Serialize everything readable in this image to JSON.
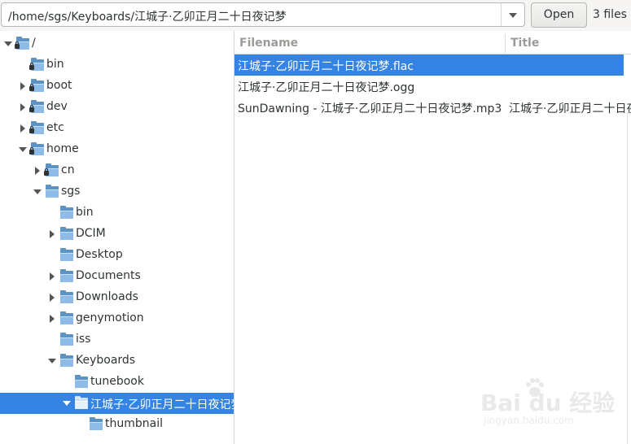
{
  "path_bar": {
    "path": "/home/sgs/Keyboards/江城子·乙卯正月二十日夜记梦",
    "open_label": "Open",
    "file_count": "3 files"
  },
  "tree": [
    {
      "label": "/",
      "depth": 0,
      "state": "expanded",
      "locked": true,
      "selected": false
    },
    {
      "label": "bin",
      "depth": 1,
      "state": "none",
      "locked": true,
      "selected": false
    },
    {
      "label": "boot",
      "depth": 1,
      "state": "collapsed",
      "locked": true,
      "selected": false
    },
    {
      "label": "dev",
      "depth": 1,
      "state": "collapsed",
      "locked": true,
      "selected": false
    },
    {
      "label": "etc",
      "depth": 1,
      "state": "collapsed",
      "locked": true,
      "selected": false
    },
    {
      "label": "home",
      "depth": 1,
      "state": "expanded",
      "locked": true,
      "selected": false
    },
    {
      "label": "cn",
      "depth": 2,
      "state": "collapsed",
      "locked": true,
      "selected": false
    },
    {
      "label": "sgs",
      "depth": 2,
      "state": "expanded",
      "locked": false,
      "selected": false
    },
    {
      "label": "bin",
      "depth": 3,
      "state": "none",
      "locked": false,
      "selected": false
    },
    {
      "label": "DCIM",
      "depth": 3,
      "state": "collapsed",
      "locked": false,
      "selected": false
    },
    {
      "label": "Desktop",
      "depth": 3,
      "state": "none",
      "locked": false,
      "selected": false
    },
    {
      "label": "Documents",
      "depth": 3,
      "state": "collapsed",
      "locked": false,
      "selected": false
    },
    {
      "label": "Downloads",
      "depth": 3,
      "state": "collapsed",
      "locked": false,
      "selected": false
    },
    {
      "label": "genymotion",
      "depth": 3,
      "state": "collapsed",
      "locked": false,
      "selected": false
    },
    {
      "label": "iss",
      "depth": 3,
      "state": "none",
      "locked": false,
      "selected": false
    },
    {
      "label": "Keyboards",
      "depth": 3,
      "state": "expanded",
      "locked": false,
      "selected": false
    },
    {
      "label": "tunebook",
      "depth": 4,
      "state": "none",
      "locked": false,
      "selected": false
    },
    {
      "label": "江城子·乙卯正月二十日夜记梦",
      "depth": 4,
      "state": "expanded",
      "locked": false,
      "selected": true
    },
    {
      "label": "thumbnail",
      "depth": 5,
      "state": "none",
      "locked": false,
      "selected": false
    }
  ],
  "file_list": {
    "columns": [
      "Filename",
      "Title"
    ],
    "rows": [
      {
        "filename": "江城子·乙卯正月二十日夜记梦.flac",
        "title": "",
        "selected": true
      },
      {
        "filename": "江城子·乙卯正月二十日夜记梦.ogg",
        "title": "",
        "selected": false
      },
      {
        "filename": "SunDawning - 江城子·乙卯正月二十日夜记梦.mp3",
        "title": "江城子·乙卯正月二十日夜记梦",
        "selected": false
      }
    ]
  },
  "watermark": {
    "logo": "Bai du 经验",
    "url": "jingyan.baidu.com"
  },
  "colors": {
    "selection": "#3584e4",
    "folder": "#5b93c5"
  }
}
